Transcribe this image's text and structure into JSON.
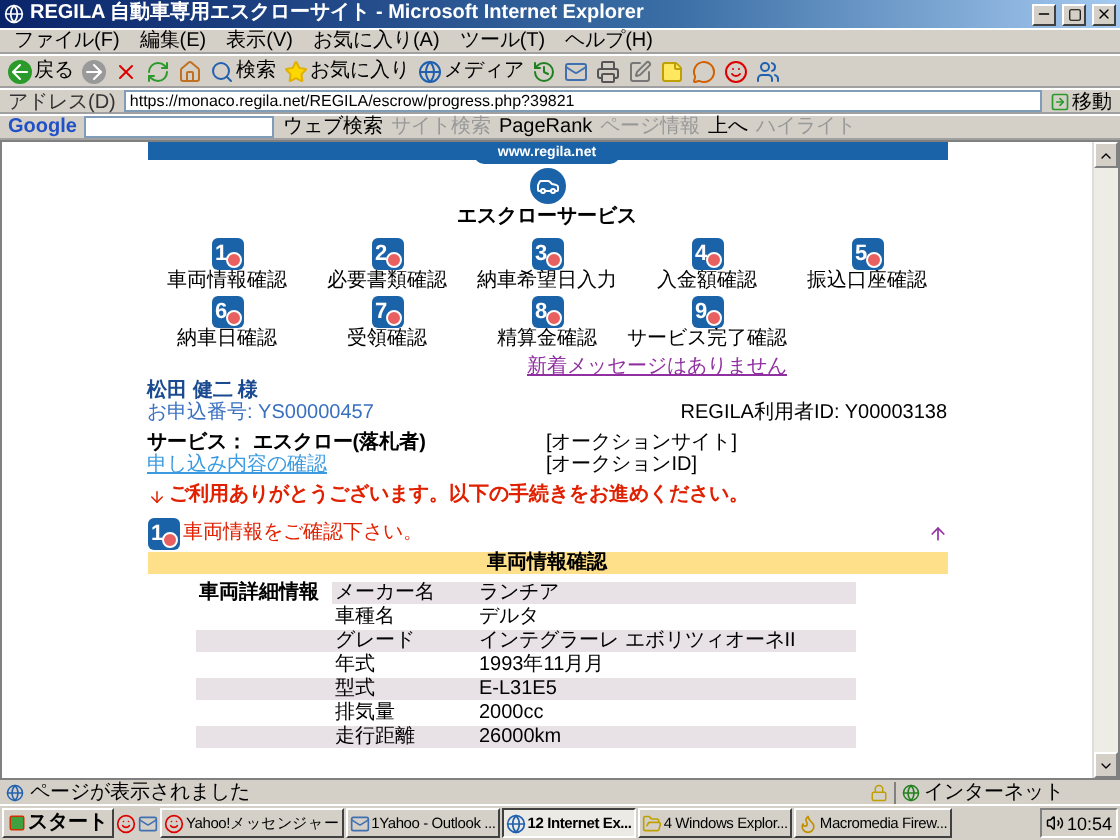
{
  "window": {
    "title": "REGILA  自動車専用エスクローサイト - Microsoft Internet Explorer"
  },
  "menu": [
    "ファイル(F)",
    "編集(E)",
    "表示(V)",
    "お気に入り(A)",
    "ツール(T)",
    "ヘルプ(H)"
  ],
  "toolbar": [
    {
      "kind": "back",
      "label": "戻る"
    },
    {
      "kind": "forward"
    },
    {
      "kind": "stop"
    },
    {
      "kind": "refresh"
    },
    {
      "kind": "home"
    },
    {
      "kind": "search",
      "label": "検索"
    },
    {
      "kind": "favorites",
      "label": "お気に入り"
    },
    {
      "kind": "media",
      "label": "メディア"
    },
    {
      "kind": "history"
    },
    {
      "kind": "mail"
    },
    {
      "kind": "print"
    },
    {
      "kind": "edit"
    },
    {
      "kind": "note"
    },
    {
      "kind": "messenger"
    },
    {
      "kind": "yahoo"
    },
    {
      "kind": "network"
    }
  ],
  "address": {
    "label": "アドレス(D)",
    "value": "https://monaco.regila.net/REGILA/escrow/progress.php?39821",
    "go": "移動"
  },
  "google_bar": {
    "logo": "Google",
    "items": [
      {
        "label": "ウェブ検索",
        "disabled": false
      },
      {
        "label": "サイト検索",
        "disabled": true
      },
      {
        "label": "PageRank",
        "disabled": false
      },
      {
        "label": "ページ情報",
        "disabled": true
      },
      {
        "label": "上へ",
        "disabled": false
      },
      {
        "label": "ハイライト",
        "disabled": true
      }
    ]
  },
  "page": {
    "banner": "www.regila.net",
    "title": "エスクローサービス",
    "steps": [
      {
        "number": "1",
        "label": "車両情報確認"
      },
      {
        "number": "2",
        "label": "必要書類確認"
      },
      {
        "number": "3",
        "label": "納車希望日入力"
      },
      {
        "number": "4",
        "label": "入金額確認"
      },
      {
        "number": "5",
        "label": "振込口座確認"
      },
      {
        "number": "6",
        "label": "納車日確認"
      },
      {
        "number": "7",
        "label": "受領確認"
      },
      {
        "number": "8",
        "label": "精算金確認"
      },
      {
        "number": "9",
        "label": "サービス完了確認"
      }
    ],
    "message_link": "新着メッセージはありません",
    "customer_name": "松田 健二 様",
    "application_number": "お申込番号: YS00000457",
    "user_id": "REGILA利用者ID: Y00003138",
    "service": "サービス： エスクロー(落札者)",
    "details_link": "申し込み内容の確認",
    "auction_site": "[オークションサイト]",
    "auction_id": "[オークションID]",
    "notice": "ご利用ありがとうございます。以下の手続きをお進めください。",
    "section": {
      "number": "1",
      "heading": "車両情報をご確認下さい。",
      "band": "車両情報確認",
      "group": "車両詳細情報",
      "rows": [
        {
          "label": "メーカー名",
          "value": "ランチア"
        },
        {
          "label": "車種名",
          "value": "デルタ"
        },
        {
          "label": "グレード",
          "value": "インテグラーレ エボリツィオーネII"
        },
        {
          "label": "年式",
          "value": "1993年11月月"
        },
        {
          "label": "型式",
          "value": "E-L31E5"
        },
        {
          "label": "排気量",
          "value": "2000cc"
        },
        {
          "label": "走行距離",
          "value": "26000km"
        }
      ]
    }
  },
  "status_bar": {
    "text": "ページが表示されました",
    "zone": "インターネット"
  },
  "taskbar": {
    "start": "スタート",
    "buttons": [
      {
        "kind": "messenger",
        "label": "Yahoo!メッセンジャー",
        "selected": false
      },
      {
        "kind": "mail",
        "label": "1Yahoo - Outlook ...",
        "selected": false
      },
      {
        "kind": "ie",
        "label": "12 Internet Ex...",
        "selected": true
      },
      {
        "kind": "folder",
        "label": "4 Windows Explor...",
        "selected": false
      },
      {
        "kind": "fw",
        "label": "Macromedia Firew...",
        "selected": false
      }
    ],
    "clock": "10:54"
  }
}
